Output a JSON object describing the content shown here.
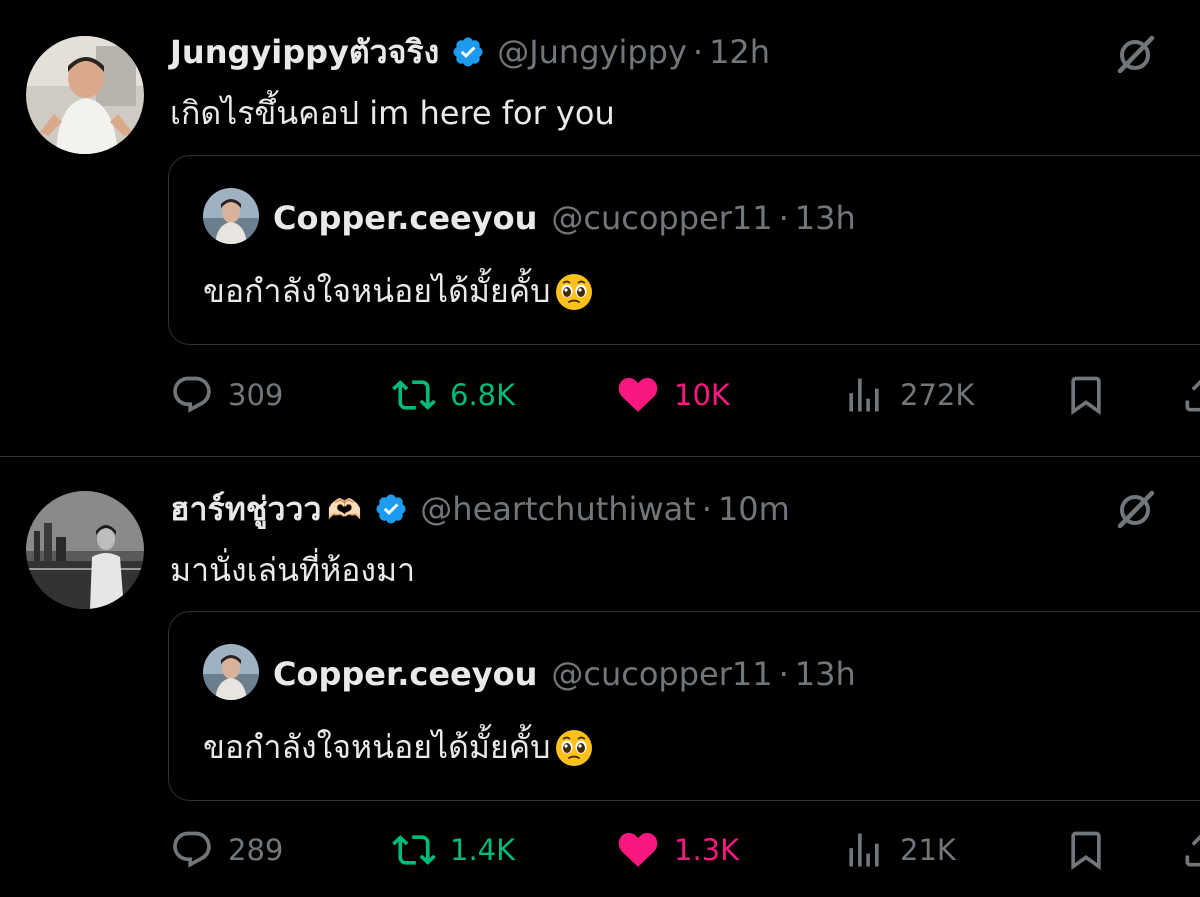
{
  "tweets": [
    {
      "author": "Jungyippyตัวจริง",
      "handle": "@Jungyippy",
      "separator": "·",
      "time": "12h",
      "text": "เกิดไรขึ้นคอป im here for you",
      "name_emoji": "",
      "quote": {
        "author": "Copper.ceeyou",
        "handle": "@cucopper11",
        "separator": "·",
        "time": "13h",
        "text": "ขอกำลังใจหน่อยได้มั้ยคั้บ"
      },
      "stats": {
        "replies": "309",
        "retweets": "6.8K",
        "likes": "10K",
        "views": "272K"
      }
    },
    {
      "author": "ฮาร์ทชู่ววว",
      "handle": "@heartchuthiwat",
      "separator": "·",
      "time": "10m",
      "text": "มานั่งเล่นที่ห้องมา",
      "name_emoji": "🫶🏻",
      "quote": {
        "author": "Copper.ceeyou",
        "handle": "@cucopper11",
        "separator": "·",
        "time": "13h",
        "text": "ขอกำลังใจหน่อยได้มั้ยคั้บ"
      },
      "stats": {
        "replies": "289",
        "retweets": "1.4K",
        "likes": "1.3K",
        "views": "21K"
      }
    }
  ],
  "colors": {
    "background": "#000000",
    "text_primary": "#e7e9ea",
    "text_secondary": "#71767b",
    "retweet": "#00ba7c",
    "like": "#f91880",
    "verified": "#1d9bf0",
    "border": "#2f3336"
  },
  "icons": [
    "grok-slash-icon",
    "verified-badge-icon",
    "reply-icon",
    "retweet-icon",
    "heart-icon",
    "views-icon",
    "bookmark-icon",
    "share-icon",
    "pleading-face-emoji"
  ]
}
